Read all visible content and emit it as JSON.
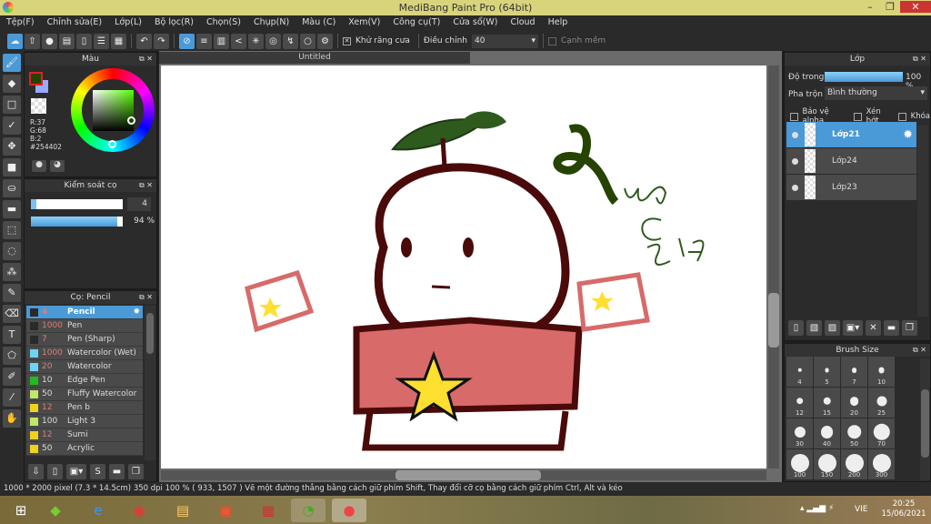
{
  "title": "MediBang Paint Pro (64bit)",
  "window_controls": [
    "minimize",
    "restore",
    "close"
  ],
  "menu": [
    "Tệp(F)",
    "Chỉnh sửa(E)",
    "Lớp(L)",
    "Bộ lọc(R)",
    "Chọn(S)",
    "Chụp(N)",
    "Màu (C)",
    "Xem(V)",
    "Công cụ(T)",
    "Cửa sổ(W)",
    "Cloud",
    "Help"
  ],
  "toolbar": {
    "antialias_label": "Khử răng cưa",
    "correction_label": "Điều chỉnh",
    "correction_value": "40",
    "soft_edge_label": "Cạnh mềm",
    "antialias_checked": true,
    "soft_edge_checked": false
  },
  "color_panel": {
    "title": "Màu",
    "r": "R:37",
    "g": "G:68",
    "b": "B:2",
    "hex": "#254402",
    "fg": "#254402",
    "bg": "#99aaff"
  },
  "brush_control": {
    "title": "Kiểm soát cọ",
    "size": "4",
    "opacity": "94 %",
    "opacity_value": 94
  },
  "brush_panel": {
    "title": "Cọ: Pencil",
    "items": [
      {
        "size": "4",
        "name": "Pencil",
        "color": "#2a2a2a",
        "selected": true,
        "red": true
      },
      {
        "size": "1000",
        "name": "Pen",
        "color": "#2a2a2a",
        "red": true
      },
      {
        "size": "7",
        "name": "Pen (Sharp)",
        "color": "#2a2a2a",
        "red": true
      },
      {
        "size": "1000",
        "name": "Watercolor (Wet)",
        "color": "#6fd3f5",
        "red": true
      },
      {
        "size": "20",
        "name": "Watercolor",
        "color": "#6fd3f5",
        "red": true
      },
      {
        "size": "10",
        "name": "Edge Pen",
        "color": "#22bb22",
        "red": false
      },
      {
        "size": "50",
        "name": "Fluffy Watercolor",
        "color": "#bde86a",
        "red": false
      },
      {
        "size": "12",
        "name": " Pen b",
        "color": "#f0d020",
        "red": true
      },
      {
        "size": "100",
        "name": "Light 3",
        "color": "#bde86a",
        "red": false
      },
      {
        "size": "12",
        "name": "Sumi",
        "color": "#f0d020",
        "red": true
      },
      {
        "size": "50",
        "name": "Acrylic",
        "color": "#f0d020",
        "red": false
      }
    ]
  },
  "canvas": {
    "tab": "Untitled"
  },
  "layer_panel": {
    "title": "Lớp",
    "opacity_label": "Độ trong",
    "opacity": "100 %",
    "opacity_value": 100,
    "blend_label": "Pha trộn",
    "blend_value": "Bình thường",
    "protect_alpha": "Bảo vệ alpha",
    "clipping": "Xén bớt",
    "lock": "Khóa",
    "layers": [
      {
        "name": "Lớp21",
        "selected": true
      },
      {
        "name": "Lớp24"
      },
      {
        "name": "Lớp23"
      }
    ]
  },
  "brush_size_panel": {
    "title": "Brush Size",
    "sizes": [
      "4",
      "5",
      "7",
      "10",
      "12",
      "15",
      "20",
      "25",
      "30",
      "40",
      "50",
      "70",
      "100",
      "150",
      "200",
      "300"
    ]
  },
  "status": "1000 * 2000 pixel   (7.3 * 14.5cm)   350 dpi   100 %   ( 933, 1507 )  Vẽ một đường thẳng bằng cách giữ phím Shift, Thay đổi cỡ cọ bằng cách giữ phím Ctrl, Alt và kéo",
  "tray": {
    "lang": "VIE",
    "time": "20:25",
    "date": "15/06/2021"
  }
}
